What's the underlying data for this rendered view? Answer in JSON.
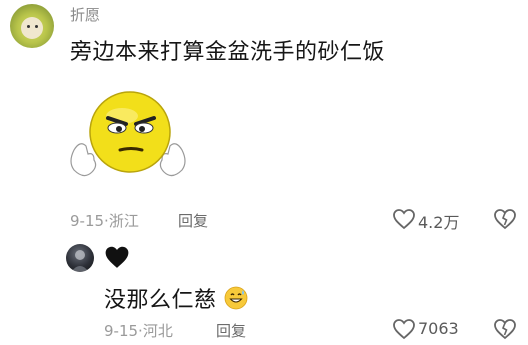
{
  "comment1": {
    "username": "折愿",
    "text": "旁边本来打算金盆洗手的砂仁饭",
    "date": "9-15",
    "location": "浙江",
    "reply_label": "回复",
    "likes": "4.2万"
  },
  "comment2": {
    "username_emoji": "🖤",
    "text": "没那么仁慈",
    "date": "9-15",
    "location": "河北",
    "reply_label": "回复",
    "likes": "7063"
  },
  "separator": "·",
  "icons": {
    "like": "heart-outline-icon",
    "dislike": "broken-heart-outline-icon",
    "sticker": "angry-yellow-emoji-sticker",
    "grin": "grinning-sweat-emoji"
  },
  "colors": {
    "text": "#161616",
    "meta": "#9a9a9a",
    "username": "#8a8a8a",
    "sticker_yellow": "#f4e21c"
  }
}
